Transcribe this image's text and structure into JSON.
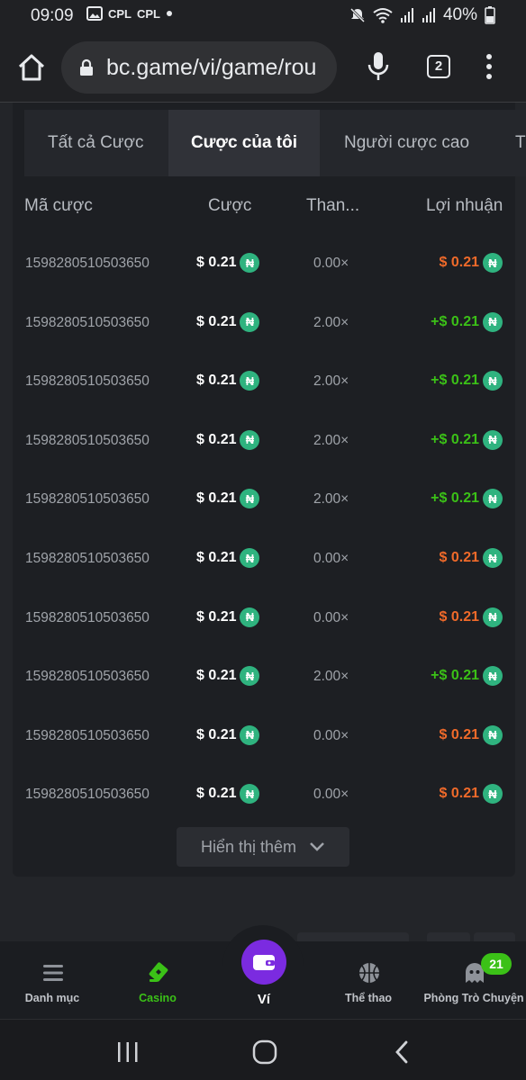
{
  "status_bar": {
    "time": "09:09",
    "battery": "40%",
    "carrier_badges": [
      "CPL",
      "CPL"
    ]
  },
  "browser": {
    "url": "bc.game/vi/game/rou",
    "tab_count": "2"
  },
  "bet_tabs": [
    {
      "label": "Tất cả Cược",
      "active": false
    },
    {
      "label": "Cược của tôi",
      "active": true
    },
    {
      "label": "Người cược cao",
      "active": false
    },
    {
      "label": "T",
      "active": false
    }
  ],
  "table": {
    "headers": {
      "id": "Mã cược",
      "bet": "Cược",
      "multiplier": "Than...",
      "profit": "Lợi nhuận"
    },
    "rows": [
      {
        "id": "1598280510503650",
        "bet": "$ 0.21",
        "multiplier": "0.00×",
        "profit": "$ 0.21",
        "win": false
      },
      {
        "id": "1598280510503650",
        "bet": "$ 0.21",
        "multiplier": "2.00×",
        "profit": "+$ 0.21",
        "win": true
      },
      {
        "id": "1598280510503650",
        "bet": "$ 0.21",
        "multiplier": "2.00×",
        "profit": "+$ 0.21",
        "win": true
      },
      {
        "id": "1598280510503650",
        "bet": "$ 0.21",
        "multiplier": "2.00×",
        "profit": "+$ 0.21",
        "win": true
      },
      {
        "id": "1598280510503650",
        "bet": "$ 0.21",
        "multiplier": "2.00×",
        "profit": "+$ 0.21",
        "win": true
      },
      {
        "id": "1598280510503650",
        "bet": "$ 0.21",
        "multiplier": "0.00×",
        "profit": "$ 0.21",
        "win": false
      },
      {
        "id": "1598280510503650",
        "bet": "$ 0.21",
        "multiplier": "0.00×",
        "profit": "$ 0.21",
        "win": false
      },
      {
        "id": "1598280510503650",
        "bet": "$ 0.21",
        "multiplier": "2.00×",
        "profit": "+$ 0.21",
        "win": true
      },
      {
        "id": "1598280510503650",
        "bet": "$ 0.21",
        "multiplier": "0.00×",
        "profit": "$ 0.21",
        "win": false
      },
      {
        "id": "1598280510503650",
        "bet": "$ 0.21",
        "multiplier": "0.00×",
        "profit": "$ 0.21",
        "win": false
      }
    ],
    "coin_symbol": "₦"
  },
  "show_more": "Hiển thị thêm",
  "bottom_nav": {
    "menu": "Danh mục",
    "casino": "Casino",
    "wallet": "Ví",
    "sports": "Thể thao",
    "chat": "Phòng Trò Chuyện",
    "chat_badge": "21"
  },
  "colors": {
    "win": "#3bc117",
    "loss": "#f06a2a",
    "coin": "#2fb37f",
    "wallet": "#7b2be0"
  }
}
